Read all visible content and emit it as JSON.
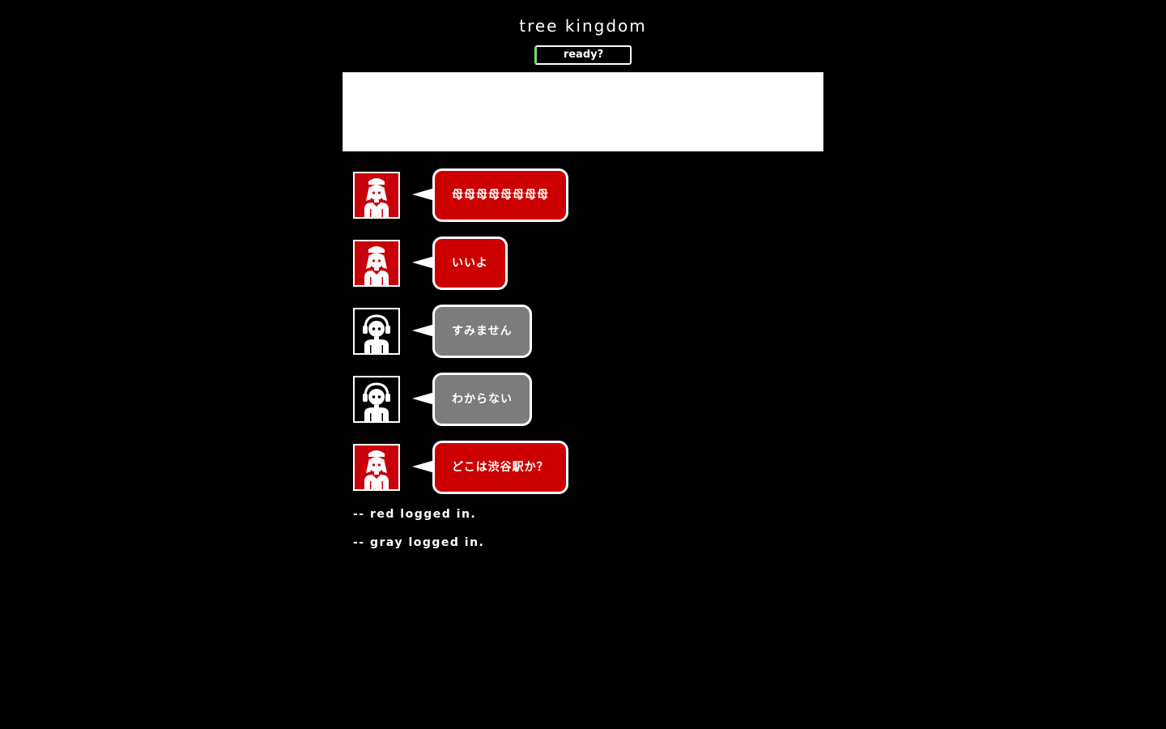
{
  "app": {
    "title": "tree kingdom",
    "ready_label": "ready?",
    "input_value": "",
    "input_placeholder": ""
  },
  "colors": {
    "background": "#000000",
    "red_user": "#cc0000",
    "gray_user": "#7c7c7c",
    "ready_accent": "#6fdc6f"
  },
  "messages": [
    {
      "user": "red",
      "avatar_icon": "girl-avatar-icon",
      "text": "母母母母母母母母"
    },
    {
      "user": "red",
      "avatar_icon": "girl-avatar-icon",
      "text": "いいよ"
    },
    {
      "user": "gray",
      "avatar_icon": "headphones-avatar-icon",
      "text": "すみません"
    },
    {
      "user": "gray",
      "avatar_icon": "headphones-avatar-icon",
      "text": "わからない"
    },
    {
      "user": "red",
      "avatar_icon": "girl-avatar-icon",
      "text": "どこは渋谷駅か？"
    }
  ],
  "system_log": [
    "-- red logged in.",
    "-- gray logged in."
  ]
}
